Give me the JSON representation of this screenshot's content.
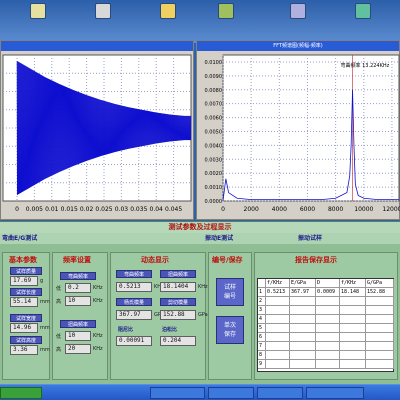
{
  "colors": {
    "accent": "#2a5bd7",
    "panel": "#8fbe95",
    "label_btn": "#4a55b8",
    "title_red": "#c01010",
    "signal": "#1010d0",
    "spectrum": "#1010d0",
    "peak_marker": "#c02020"
  },
  "desktop": {
    "icons": [
      "",
      "",
      "",
      "",
      "",
      ""
    ]
  },
  "time_plot": {
    "title": "",
    "x_ticks": [
      "0",
      "0.005",
      "0.01",
      "0.015",
      "0.02",
      "0.025",
      "0.03",
      "0.035",
      "0.04",
      "0.045"
    ]
  },
  "fft_plot": {
    "title": "FFT频谱图(频幅-频率)",
    "y_ticks": [
      "0.0100",
      "0.0090",
      "0.0080",
      "0.0070",
      "0.0060",
      "0.0050",
      "0.0040",
      "0.0030",
      "0.0020",
      "0.0010",
      "0.0000"
    ],
    "x_ticks": [
      "0",
      "2000",
      "4000",
      "6000",
      "8000",
      "10000",
      "12000"
    ],
    "peak_label": "弯曲频率 13.224KHz",
    "peak_label_cut": ""
  },
  "chart_data": [
    {
      "type": "line",
      "title": "",
      "xlabel": "",
      "ylabel": "",
      "xlim": [
        0,
        0.05
      ],
      "grid": true,
      "series": [
        {
          "values_description_note": "",
          "x": [
            0,
            0.004,
            0.008,
            0.012,
            0.016,
            0.02,
            0.024,
            0.028,
            0.032,
            0.036,
            0.04,
            0.044,
            0.048
          ],
          "y": [
            1.0,
            0.88,
            0.76,
            0.66,
            0.57,
            0.49,
            0.42,
            0.36,
            0.31,
            0.27,
            0.23,
            0.2,
            0.18
          ]
        }
      ]
    },
    {
      "type": "line",
      "title": "FFT频谱图(频幅-频率)",
      "xlabel": "",
      "ylabel": "",
      "xlim": [
        0,
        12500
      ],
      "ylim": [
        0,
        0.0105
      ],
      "grid": true,
      "x": [
        0,
        200,
        400,
        1000,
        2000,
        3000,
        4000,
        5000,
        6000,
        7000,
        8000,
        8800,
        9000,
        9100,
        9200,
        9300,
        9400,
        9600,
        10000,
        11000,
        12000,
        12500
      ],
      "y": [
        0.0,
        0.0016,
        0.0006,
        0.0002,
        0.0001,
        0.0001,
        0.0001,
        0.0001,
        0.0001,
        0.0001,
        0.0002,
        0.0006,
        0.0018,
        0.004,
        0.008,
        0.004,
        0.0012,
        0.0004,
        0.0002,
        0.0001,
        0.0001,
        0.0001
      ]
    }
  ],
  "main": {
    "title": "测试参数及过程显示",
    "menu": [
      "弯曲E/G测试",
      "",
      "",
      "",
      "",
      "振动E测试",
      "",
      "振动试样"
    ],
    "basic": {
      "head": "基本参数",
      "rows": [
        {
          "label": "试样质量",
          "value": "17.69",
          "unit": "g"
        },
        {
          "label": "试样长度",
          "value": "55.14",
          "unit": "mm"
        },
        {
          "label": "试样宽度",
          "value": "14.96",
          "unit": "mm"
        },
        {
          "label": "试样高度",
          "value": "3.36",
          "unit": "mm"
        }
      ]
    },
    "freq": {
      "head": "频率设置",
      "bend_label": "弯曲频率",
      "bend_min": "0.2",
      "bend_max": "10",
      "tors_label": "扭曲频率",
      "tors_min": "10",
      "tors_max": "20",
      "unit": "KHz",
      "min_caption": "低",
      "max_caption": "高"
    },
    "dyn": {
      "head": "动态显示",
      "bend_freq_label": "弯曲频率",
      "bend_freq": "0.5213",
      "bend_freq_unit": "KHz",
      "tors_freq_label": "扭曲频率",
      "tors_freq": "18.1404",
      "tors_freq_unit": "KHz",
      "youngs_label": "杨氏模量",
      "youngs": "367.97",
      "youngs_unit": "GPa",
      "shear_label": "剪切模量",
      "shear": "152.88",
      "shear_unit": "GPa",
      "damp_label": "阻尼比",
      "damp": "0.00091",
      "poisson_label": "泊松比",
      "poisson": "0.204"
    },
    "save": {
      "head": "编号/保存",
      "num_btn": "试样\n编号",
      "save_btn": "单次\n保存"
    },
    "report": {
      "head": "报告保存显示",
      "columns": [
        "",
        "f/KHz",
        "E/GPa",
        "D",
        "f/KHz",
        "G/GPa"
      ],
      "rows": [
        [
          "1",
          "0.5213",
          "367.97",
          "0.0009",
          "18.148",
          "152.88"
        ],
        [
          "2",
          "",
          "",
          "",
          "",
          ""
        ],
        [
          "3",
          "",
          "",
          "",
          "",
          ""
        ],
        [
          "4",
          "",
          "",
          "",
          "",
          ""
        ],
        [
          "5",
          "",
          "",
          "",
          "",
          ""
        ],
        [
          "6",
          "",
          "",
          "",
          "",
          ""
        ],
        [
          "7",
          "",
          "",
          "",
          "",
          ""
        ],
        [
          "8",
          "",
          "",
          "",
          "",
          ""
        ],
        [
          "9",
          "",
          "",
          "",
          "",
          ""
        ]
      ]
    }
  },
  "taskbar": {
    "tasks": [
      "",
      "",
      "",
      "",
      ""
    ]
  },
  "watermark": ""
}
